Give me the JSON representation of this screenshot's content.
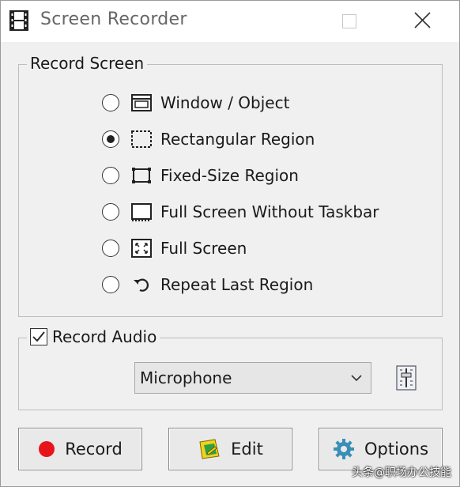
{
  "window": {
    "title": "Screen Recorder"
  },
  "record_screen": {
    "legend": "Record Screen",
    "options": [
      {
        "label": "Window / Object",
        "icon": "window-object-icon",
        "selected": false
      },
      {
        "label": "Rectangular Region",
        "icon": "rectangular-region-icon",
        "selected": true
      },
      {
        "label": "Fixed-Size Region",
        "icon": "fixed-size-region-icon",
        "selected": false
      },
      {
        "label": "Full Screen Without Taskbar",
        "icon": "full-screen-without-taskbar-icon",
        "selected": false
      },
      {
        "label": "Full Screen",
        "icon": "full-screen-icon",
        "selected": false
      },
      {
        "label": "Repeat Last Region",
        "icon": "repeat-last-region-icon",
        "selected": false
      }
    ]
  },
  "record_audio": {
    "label": "Record Audio",
    "checked": true,
    "source": "Microphone"
  },
  "buttons": {
    "record": "Record",
    "edit": "Edit",
    "options": "Options"
  },
  "colors": {
    "record_dot": "#e8141c",
    "edit_icon_yellow": "#f2d21b",
    "edit_icon_green": "#2ea043",
    "options_gear": "#3a8fb7"
  },
  "watermark": "头条@职场办公技能"
}
